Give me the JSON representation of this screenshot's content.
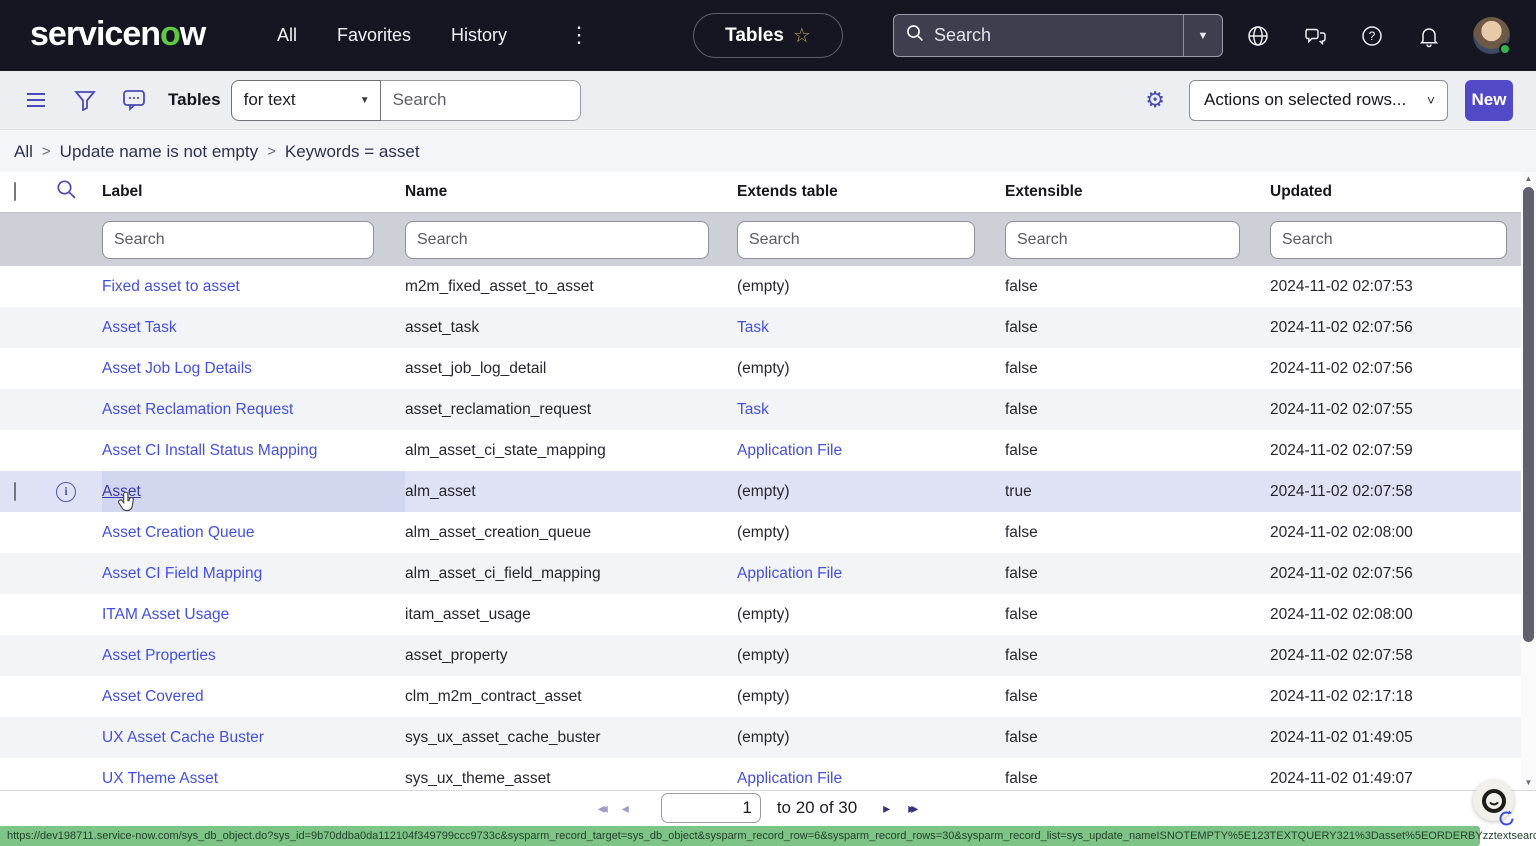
{
  "header": {
    "logo_prefix": "servicen",
    "logo_o": "o",
    "logo_suffix": "w",
    "nav": [
      "All",
      "Favorites",
      "History"
    ],
    "more_menu_glyph": "⋮",
    "pinned_tab": {
      "label": "Tables",
      "star_glyph": "☆"
    },
    "global_search": {
      "placeholder": "Search",
      "dropdown_glyph": "▼"
    }
  },
  "toolbar": {
    "list_title": "Tables",
    "search_type_value": "for text",
    "search_type_caret": "▼",
    "search_placeholder": "Search",
    "gear_glyph": "⚙",
    "actions_dropdown_label": "Actions on selected rows...",
    "actions_caret": "˅",
    "new_button_label": "New"
  },
  "breadcrumb": {
    "items": [
      "All",
      "Update name is not empty",
      "Keywords = asset"
    ],
    "separator": ">"
  },
  "table": {
    "columns": [
      "Label",
      "Name",
      "Extends table",
      "Extensible",
      "Updated"
    ],
    "filter_placeholder": "Search",
    "rows": [
      {
        "label": "Fixed asset to asset",
        "name": "m2m_fixed_asset_to_asset",
        "extends": "(empty)",
        "extends_is_link": false,
        "extensible": "false",
        "updated": "2024-11-02 02:07:53",
        "hovered": false
      },
      {
        "label": "Asset Task",
        "name": "asset_task",
        "extends": "Task",
        "extends_is_link": true,
        "extensible": "false",
        "updated": "2024-11-02 02:07:56",
        "hovered": false
      },
      {
        "label": "Asset Job Log Details",
        "name": "asset_job_log_detail",
        "extends": "(empty)",
        "extends_is_link": false,
        "extensible": "false",
        "updated": "2024-11-02 02:07:56",
        "hovered": false
      },
      {
        "label": "Asset Reclamation Request",
        "name": "asset_reclamation_request",
        "extends": "Task",
        "extends_is_link": true,
        "extensible": "false",
        "updated": "2024-11-02 02:07:55",
        "hovered": false
      },
      {
        "label": "Asset CI Install Status Mapping",
        "name": "alm_asset_ci_state_mapping",
        "extends": "Application File",
        "extends_is_link": true,
        "extensible": "false",
        "updated": "2024-11-02 02:07:59",
        "hovered": false
      },
      {
        "label": "Asset",
        "name": "alm_asset",
        "extends": "(empty)",
        "extends_is_link": false,
        "extensible": "true",
        "updated": "2024-11-02 02:07:58",
        "hovered": true
      },
      {
        "label": "Asset Creation Queue",
        "name": "alm_asset_creation_queue",
        "extends": "(empty)",
        "extends_is_link": false,
        "extensible": "false",
        "updated": "2024-11-02 02:08:00",
        "hovered": false
      },
      {
        "label": "Asset CI Field Mapping",
        "name": "alm_asset_ci_field_mapping",
        "extends": "Application File",
        "extends_is_link": true,
        "extensible": "false",
        "updated": "2024-11-02 02:07:56",
        "hovered": false
      },
      {
        "label": "ITAM Asset Usage",
        "name": "itam_asset_usage",
        "extends": "(empty)",
        "extends_is_link": false,
        "extensible": "false",
        "updated": "2024-11-02 02:08:00",
        "hovered": false
      },
      {
        "label": "Asset Properties",
        "name": "asset_property",
        "extends": "(empty)",
        "extends_is_link": false,
        "extensible": "false",
        "updated": "2024-11-02 02:07:58",
        "hovered": false
      },
      {
        "label": "Asset Covered",
        "name": "clm_m2m_contract_asset",
        "extends": "(empty)",
        "extends_is_link": false,
        "extensible": "false",
        "updated": "2024-11-02 02:17:18",
        "hovered": false
      },
      {
        "label": "UX Asset Cache Buster",
        "name": "sys_ux_asset_cache_buster",
        "extends": "(empty)",
        "extends_is_link": false,
        "extensible": "false",
        "updated": "2024-11-02 01:49:05",
        "hovered": false
      },
      {
        "label": "UX Theme Asset",
        "name": "sys_ux_theme_asset",
        "extends": "Application File",
        "extends_is_link": true,
        "extensible": "false",
        "updated": "2024-11-02 01:49:07",
        "hovered": false
      }
    ]
  },
  "pagination": {
    "first_glyph": "◂◂",
    "prev_glyph": "◂",
    "current_page": "1",
    "range_text": "to 20 of 30",
    "next_glyph": "▸",
    "last_glyph": "▸▸"
  },
  "status_bar": {
    "url": "https://dev198711.service-now.com/sys_db_object.do?sys_id=9b70ddba0da112104f349799ccc9733c&sysparm_record_target=sys_db_object&sysparm_record_row=6&sysparm_record_rows=30&sysparm_record_list=sys_update_nameISNOTEMPTY%5E123TEXTQUERY321%3Dasset%5EORDERBYzztextsearchyy"
  },
  "colors": {
    "header_bg": "#161622",
    "accent_indigo": "#5149c6",
    "link_blue": "#4250df",
    "hover_row_bg": "#dfe1f4",
    "status_bar_green": "#7ec487",
    "logo_green": "#62c744"
  }
}
